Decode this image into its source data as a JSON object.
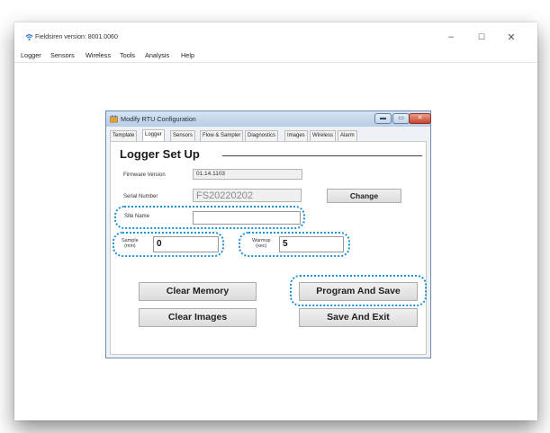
{
  "app": {
    "title": "Fieldsiren version: 8001.0060",
    "menu": [
      "Logger",
      "Sensors",
      "Wireless",
      "Tools",
      "Analysis",
      "Help"
    ],
    "controls": {
      "minimize": "–",
      "maximize": "☐",
      "close": "✕"
    }
  },
  "dialog": {
    "title": "Modify RTU Configuration",
    "tabs": [
      "Template",
      "Logger",
      "Sensors",
      "Flow & Sampler",
      "Diagnostics",
      "Images",
      "Wireless",
      "Alarm"
    ],
    "active_tab": "Logger",
    "group_title": "Logger Set Up",
    "firmware_label": "Firmware   Version",
    "firmware_value": "01.14.1103",
    "serial_label": "Serial Number",
    "serial_value": "FS20220202",
    "change_button": "Change",
    "site_name_label": "Site Name",
    "site_name_value": "",
    "sample_label_1": "Sample",
    "sample_label_2": "(min)",
    "sample_value": "0",
    "warmup_label_1": "Warmup",
    "warmup_label_2": "(sec)",
    "warmup_value": "5",
    "buttons": {
      "clear_memory": "Clear Memory",
      "program_and_save": "Program And Save",
      "clear_images": "Clear Images",
      "save_and_exit": "Save And Exit"
    }
  },
  "colors": {
    "highlight": "#1e8ed6",
    "dialog_border": "#6d8db4",
    "close_red": "#c9432c"
  }
}
